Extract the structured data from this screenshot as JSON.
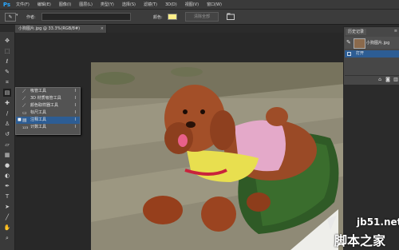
{
  "app": {
    "logo": "Ps"
  },
  "menubar": {
    "items": [
      "文件(F)",
      "编辑(E)",
      "图像(I)",
      "图层(L)",
      "类型(Y)",
      "选择(S)",
      "滤镜(T)",
      "3D(D)",
      "视图(V)",
      "窗口(W)"
    ]
  },
  "options": {
    "author_label": "作者:",
    "author_value": "",
    "color_label": "颜色:",
    "color_value": "#ffef8a",
    "clear_label": "清除全部"
  },
  "document_tab": {
    "title": "小狗图片.jpg @ 33.3%(RGB/8#)",
    "close": "×"
  },
  "tool_flyout": {
    "items": [
      {
        "label": "吸管工具",
        "shortcut": "I",
        "icon": "eyedropper-icon",
        "selected": false
      },
      {
        "label": "3D 材质吸管工具",
        "shortcut": "I",
        "icon": "3d-material-eyedropper-icon",
        "selected": false
      },
      {
        "label": "颜色取样器工具",
        "shortcut": "I",
        "icon": "color-sampler-icon",
        "selected": false
      },
      {
        "label": "标尺工具",
        "shortcut": "I",
        "icon": "ruler-icon",
        "selected": false
      },
      {
        "label": "注释工具",
        "shortcut": "I",
        "icon": "note-icon",
        "selected": true
      },
      {
        "label": "计数工具",
        "shortcut": "I",
        "icon": "count-icon",
        "selected": false
      }
    ]
  },
  "history_panel": {
    "title": "历史记录",
    "snapshot_label": "小狗图片.jpg",
    "states": [
      {
        "label": "打开"
      }
    ]
  },
  "watermark": {
    "site": "jb51.net",
    "brand": "脚本之家"
  }
}
